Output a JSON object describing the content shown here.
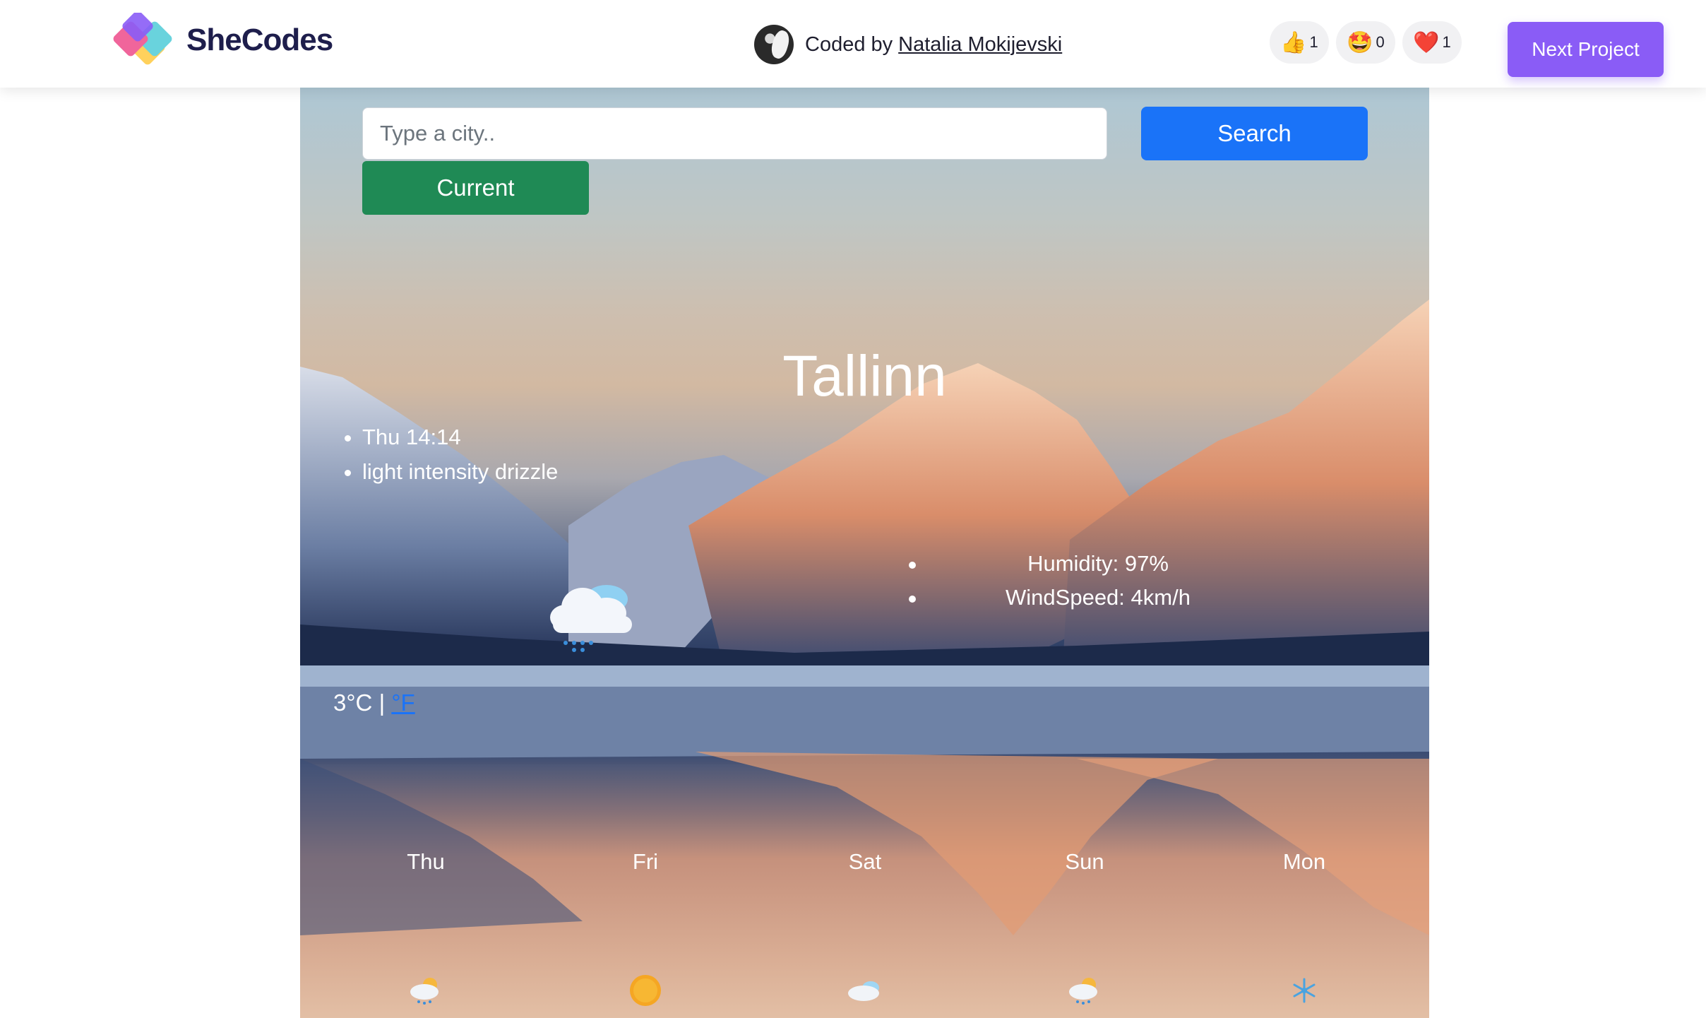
{
  "topbar": {
    "logo_text": "SheCodes",
    "coded_by": "Coded by",
    "author": "Natalia Mokijevski",
    "reactions": [
      {
        "icon": "thumbs-up-icon",
        "glyph": "👍",
        "count": "1"
      },
      {
        "icon": "star-struck-icon",
        "glyph": "🤩",
        "count": "0"
      },
      {
        "icon": "heart-icon",
        "glyph": "❤️",
        "count": "1"
      }
    ],
    "next_label": "Next Project"
  },
  "search": {
    "placeholder": "Type a city..",
    "value": "",
    "search_label": "Search",
    "current_label": "Current"
  },
  "weather": {
    "city": "Tallinn",
    "datetime": "Thu 14:14",
    "description": "light intensity drizzle",
    "humidity": "Humidity: 97%",
    "wind": "WindSpeed: 4km/h",
    "icon": "drizzle-cloud-icon",
    "temp": "3",
    "unit_c": "°C",
    "separator": "|",
    "unit_f": "°F"
  },
  "forecast": [
    {
      "day": "Thu",
      "icon": "sun-cloud-rain-icon"
    },
    {
      "day": "Fri",
      "icon": "sun-icon"
    },
    {
      "day": "Sat",
      "icon": "cloud-icon"
    },
    {
      "day": "Sun",
      "icon": "sun-cloud-rain-icon"
    },
    {
      "day": "Mon",
      "icon": "snowflake-icon"
    }
  ],
  "colors": {
    "next_button": "#8a5cf6",
    "search_button": "#1a73f8",
    "current_button": "#1f8a55",
    "link": "#1a73f8"
  }
}
